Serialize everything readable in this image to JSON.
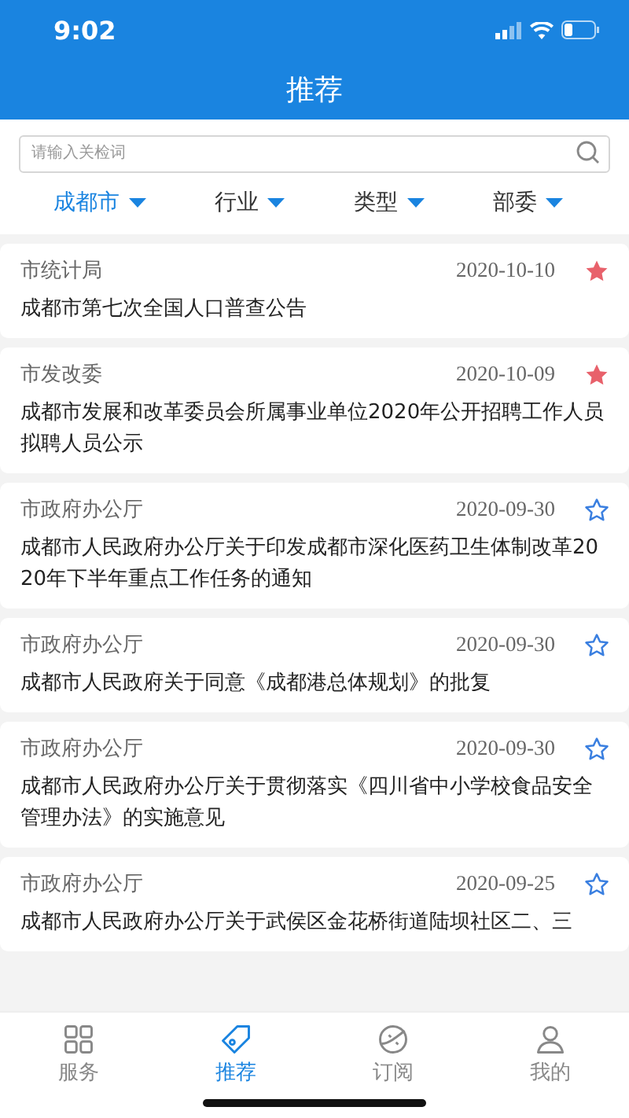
{
  "status_bar": {
    "time": "9:02"
  },
  "header": {
    "title": "推荐"
  },
  "search": {
    "placeholder": "请输入关检词"
  },
  "filters": [
    {
      "label": "成都市",
      "selected": true
    },
    {
      "label": "行业",
      "selected": false
    },
    {
      "label": "类型",
      "selected": false
    },
    {
      "label": "部委",
      "selected": false
    }
  ],
  "articles": [
    {
      "source": "市统计局",
      "date": "2020-10-10",
      "title": "成都市第七次全国人口普查公告",
      "favorited": true
    },
    {
      "source": "市发改委",
      "date": "2020-10-09",
      "title": "成都市发展和改革委员会所属事业单位2020年公开招聘工作人员拟聘人员公示",
      "favorited": true
    },
    {
      "source": "市政府办公厅",
      "date": "2020-09-30",
      "title": "成都市人民政府办公厅关于印发成都市深化医药卫生体制改革2020年下半年重点工作任务的通知",
      "favorited": false
    },
    {
      "source": "市政府办公厅",
      "date": "2020-09-30",
      "title": "成都市人民政府关于同意《成都港总体规划》的批复",
      "favorited": false
    },
    {
      "source": "市政府办公厅",
      "date": "2020-09-30",
      "title": "成都市人民政府办公厅关于贯彻落实《四川省中小学校食品安全管理办法》的实施意见",
      "favorited": false
    },
    {
      "source": "市政府办公厅",
      "date": "2020-09-25",
      "title": "成都市人民政府办公厅关于武侯区金花桥街道陆坝社区二、三",
      "favorited": false
    }
  ],
  "tab_bar": [
    {
      "label": "服务",
      "kind": "grid",
      "selected": false
    },
    {
      "label": "推荐",
      "kind": "tag",
      "selected": true
    },
    {
      "label": "订阅",
      "kind": "ball",
      "selected": false
    },
    {
      "label": "我的",
      "kind": "person",
      "selected": false
    }
  ]
}
